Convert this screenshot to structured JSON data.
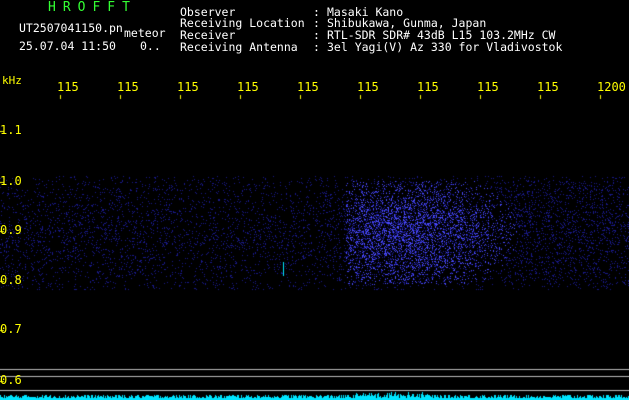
{
  "app": {
    "title": "HROFFT",
    "file_name": "UT2507041150.pn",
    "meteor_label": "meteor",
    "date_time": "25.07.04 11:50",
    "count_value": "0.."
  },
  "header": {
    "rows": [
      {
        "label": "Observer",
        "value": "Masaki Kano"
      },
      {
        "label": "Receiving Location",
        "value": "Shibukawa, Gunma, Japan"
      },
      {
        "label": "Receiver",
        "value": "RTL-SDR SDR# 43dB L15 103.2MHz CW"
      },
      {
        "label": "Receiving Antenna",
        "value": "3el Yagi(V) Az 330 for Vladivostok"
      }
    ],
    "separator": ":"
  },
  "axis": {
    "unit": "kHz",
    "x_ticks": [
      "115",
      "115",
      "115",
      "115",
      "115",
      "115",
      "115",
      "115",
      "115",
      "1200"
    ],
    "y_ticks": [
      "1.1",
      "1.0",
      "0.9",
      "0.8",
      "0.7",
      "0.6"
    ]
  },
  "colors": {
    "background": "#000000",
    "header_text": "#ffffff",
    "app_text": "#33ff33",
    "axis_text": "#ffff00",
    "signal_dim": "#1a1a8c",
    "signal_bright": "#4a4aff",
    "baseline": "#00e5ff",
    "guide_lines": "#bbbbbb"
  }
}
